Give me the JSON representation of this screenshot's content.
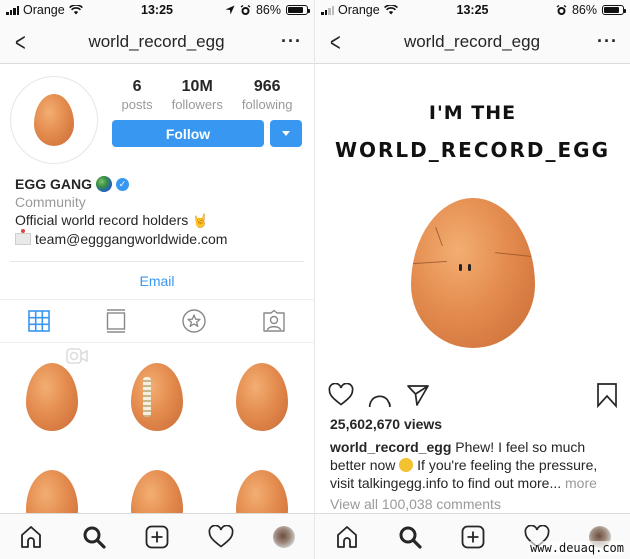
{
  "status_bar_left": {
    "carrier": "Orange",
    "time": "13:25",
    "battery": "86%",
    "battery_level": 0.86
  },
  "status_bar_right": {
    "carrier": "Orange",
    "time": "13:25",
    "battery": "86%",
    "battery_level": 0.86
  },
  "profile_screen": {
    "nav": {
      "title": "world_record_egg",
      "back_icon": "chevron-left-icon",
      "more_icon": "more-icon"
    },
    "stats": [
      {
        "value": "6",
        "label": "posts"
      },
      {
        "value": "10M",
        "label": "followers"
      },
      {
        "value": "966",
        "label": "following"
      }
    ],
    "follow_label": "Follow",
    "bio": {
      "name": "EGG GANG",
      "category": "Community",
      "line1": "Official world record holders",
      "email": "team@egggangworldwide.com"
    },
    "email_button": "Email",
    "tabs": [
      {
        "id": "grid",
        "icon": "grid-icon",
        "active": true
      },
      {
        "id": "feed",
        "icon": "feed-icon",
        "active": false
      },
      {
        "id": "saved",
        "icon": "star-icon",
        "active": false
      },
      {
        "id": "tagged",
        "icon": "tagged-icon",
        "active": false
      }
    ],
    "grid_posts": [
      {
        "type": "video",
        "variant": "cracked"
      },
      {
        "type": "photo",
        "variant": "football"
      },
      {
        "type": "photo",
        "variant": "cracked"
      },
      {
        "type": "photo",
        "variant": "cracked"
      },
      {
        "type": "photo",
        "variant": "plain"
      },
      {
        "type": "photo",
        "variant": "plain"
      }
    ]
  },
  "post_screen": {
    "nav": {
      "title": "world_record_egg"
    },
    "image_text": {
      "line1": "I'M THE",
      "line2": "WORLD_RECORD_EGG"
    },
    "views": "25,602,670 views",
    "caption": {
      "username": "world_record_egg",
      "text_part1": " Phew! I feel so much better now ",
      "text_part2": " If you're feeling the pressure, visit talkingegg.info to find out more...",
      "more": "more"
    },
    "view_comments": "View all 100,038 comments"
  },
  "tabbar": [
    {
      "id": "home",
      "icon": "home-icon"
    },
    {
      "id": "search",
      "icon": "search-icon"
    },
    {
      "id": "new-post",
      "icon": "add-post-icon"
    },
    {
      "id": "activity",
      "icon": "heart-icon"
    },
    {
      "id": "profile",
      "icon": "profile-avatar"
    }
  ],
  "watermark": "www.deuaq.com",
  "colors": {
    "accent": "#3897f0",
    "muted": "#999999",
    "text": "#262626"
  }
}
